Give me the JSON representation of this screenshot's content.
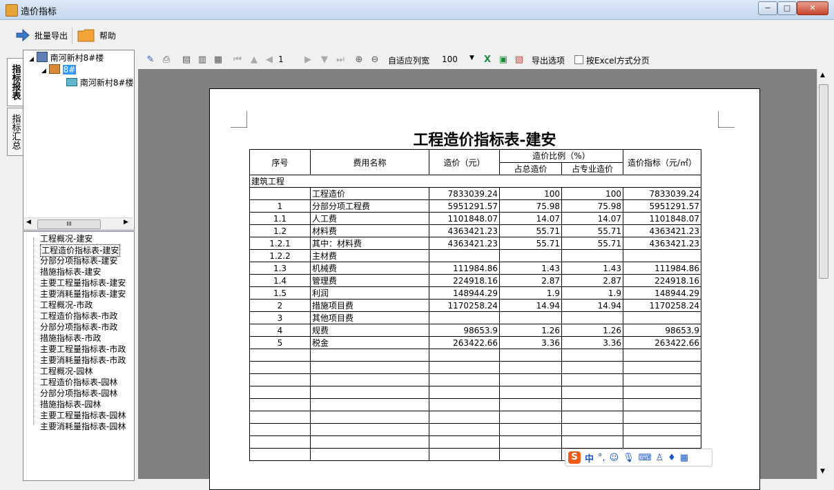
{
  "window": {
    "title": "造价指标",
    "min_label": "−",
    "max_label": "□",
    "close_label": "✕"
  },
  "main_toolbar": {
    "export_label": "批量导出",
    "help_label": "帮助"
  },
  "left_tabs": [
    "指标报表",
    "指标汇总"
  ],
  "tree": {
    "root": "南河新村8#楼",
    "child": "8#",
    "leaf": "南河新村8#楼",
    "hscroll_glyph": "III"
  },
  "report_list": [
    "工程概况-建安",
    "工程造价指标表-建安",
    "分部分项指标表-建安",
    "措施指标表-建安",
    "主要工程量指标表-建安",
    "主要消耗量指标表-建安",
    "工程概况-市政",
    "工程造价指标表-市政",
    "分部分项指标表-市政",
    "措施指标表-市政",
    "主要工程量指标表-市政",
    "主要消耗量指标表-市政",
    "工程概况-园林",
    "工程造价指标表-园林",
    "分部分项指标表-园林",
    "措施指标表-园林",
    "主要工程量指标表-园林",
    "主要消耗量指标表-园林"
  ],
  "report_toolbar": {
    "page": "1",
    "fit_width_label": "自适应列宽",
    "zoom": "100",
    "export_options_label": "导出选项",
    "excel_paging_label": "按Excel方式分页"
  },
  "report": {
    "title": "工程造价指标表-建安",
    "headers": {
      "seq": "序号",
      "name": "费用名称",
      "cost": "造价（元）",
      "ratio": "造价比例（%）",
      "ratio_total": "占总造价",
      "ratio_prof": "占专业造价",
      "index": "造价指标（元/㎡）"
    },
    "section": "建筑工程",
    "rows": [
      {
        "seq": "",
        "name": "工程造价",
        "cost": "7833039.24",
        "total": "100",
        "prof": "100",
        "index": "7833039.24"
      },
      {
        "seq": "1",
        "name": "分部分项工程费",
        "cost": "5951291.57",
        "total": "75.98",
        "prof": "75.98",
        "index": "5951291.57"
      },
      {
        "seq": "1.1",
        "name": "人工费",
        "cost": "1101848.07",
        "total": "14.07",
        "prof": "14.07",
        "index": "1101848.07"
      },
      {
        "seq": "1.2",
        "name": "材料费",
        "cost": "4363421.23",
        "total": "55.71",
        "prof": "55.71",
        "index": "4363421.23"
      },
      {
        "seq": "1.2.1",
        "name": "其中：材料费",
        "cost": "4363421.23",
        "total": "55.71",
        "prof": "55.71",
        "index": "4363421.23"
      },
      {
        "seq": "1.2.2",
        "name": "主材费",
        "cost": "",
        "total": "",
        "prof": "",
        "index": ""
      },
      {
        "seq": "1.3",
        "name": "机械费",
        "cost": "111984.86",
        "total": "1.43",
        "prof": "1.43",
        "index": "111984.86"
      },
      {
        "seq": "1.4",
        "name": "管理费",
        "cost": "224918.16",
        "total": "2.87",
        "prof": "2.87",
        "index": "224918.16"
      },
      {
        "seq": "1.5",
        "name": "利润",
        "cost": "148944.29",
        "total": "1.9",
        "prof": "1.9",
        "index": "148944.29"
      },
      {
        "seq": "2",
        "name": "措施项目费",
        "cost": "1170258.24",
        "total": "14.94",
        "prof": "14.94",
        "index": "1170258.24"
      },
      {
        "seq": "3",
        "name": "其他项目费",
        "cost": "",
        "total": "",
        "prof": "",
        "index": ""
      },
      {
        "seq": "4",
        "name": "规费",
        "cost": "98653.9",
        "total": "1.26",
        "prof": "1.26",
        "index": "98653.9"
      },
      {
        "seq": "5",
        "name": "税金",
        "cost": "263422.66",
        "total": "3.36",
        "prof": "3.36",
        "index": "263422.66"
      }
    ],
    "empty_rows": 9
  },
  "ime": {
    "brand": "S",
    "lang": "中",
    "punct": "°,",
    "icons": [
      "smile-icon",
      "mic-icon",
      "keyboard-icon",
      "user-icon",
      "shirt-icon",
      "grid-icon"
    ]
  }
}
